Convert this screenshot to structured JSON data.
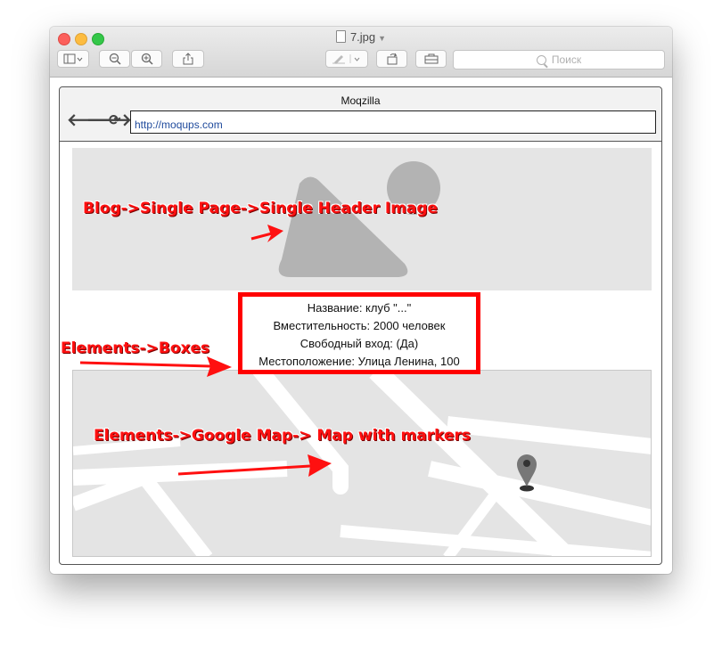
{
  "window": {
    "title": "7.jpg",
    "search_placeholder": "Поиск"
  },
  "mockup": {
    "browser_title": "Moqzilla",
    "url": "http://moqups.com",
    "info_box": {
      "lines": [
        "Название: клуб \"...\"",
        "Вместительность: 2000 человек",
        "Свободный вход: (Да)",
        "Местоположение: Улица Ленина, 100"
      ]
    }
  },
  "annotations": {
    "header_image": "Blog->Single Page->Single Header Image",
    "boxes": "Elements->Boxes",
    "google_map": "Elements->Google Map-> Map with markers"
  },
  "colors": {
    "annotation_red": "#ff1010",
    "box_border": "#ff0000",
    "placeholder_gray": "#b3b3b3"
  }
}
